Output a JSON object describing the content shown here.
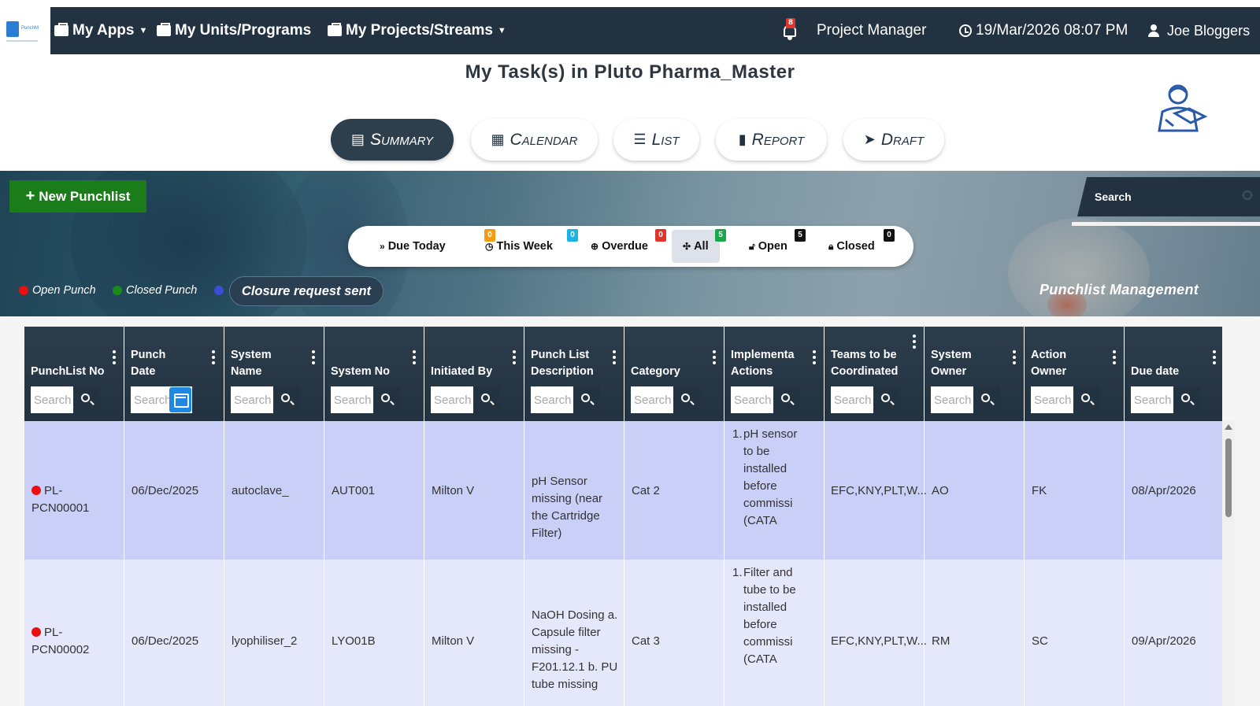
{
  "topbar": {
    "logo_text": "PunchM",
    "menus": [
      {
        "label": "My Apps",
        "has_caret": true
      },
      {
        "label": "My Units/Programs",
        "has_caret": false
      },
      {
        "label": "My Projects/Streams",
        "has_caret": true
      }
    ],
    "notification_count": "8",
    "role": "Project Manager",
    "datetime": "19/Mar/2026 08:07 PM",
    "user": "Joe Bloggers"
  },
  "page_title": "My Task(s) in Pluto Pharma_Master",
  "tabs": [
    {
      "label": "Summary",
      "icon": "summary-icon",
      "active": true
    },
    {
      "label": "Calendar",
      "icon": "calendar-icon",
      "active": false
    },
    {
      "label": "List",
      "icon": "list-icon",
      "active": false
    },
    {
      "label": "Report",
      "icon": "report-icon",
      "active": false
    },
    {
      "label": "Draft",
      "icon": "paper-plane-icon",
      "active": false
    }
  ],
  "hero": {
    "new_button": "New Punchlist",
    "search_placeholder": "Search",
    "filters": [
      {
        "label": "Due Today",
        "count": "0",
        "color": "#f39c12"
      },
      {
        "label": "This Week",
        "count": "0",
        "color": "#1ab3e6"
      },
      {
        "label": "Overdue",
        "count": "0",
        "color": "#e0342c"
      },
      {
        "label": "All",
        "count": "5",
        "color": "#1aa84a",
        "active": true
      },
      {
        "label": "Open",
        "count": "5",
        "color": "#111111"
      },
      {
        "label": "Closed",
        "count": "0",
        "color": "#111111"
      }
    ],
    "legend": [
      {
        "label": "Open Punch",
        "color": "#e81010"
      },
      {
        "label": "Closed Punch",
        "color": "#1a8a1a"
      },
      {
        "label": "Closure request sent",
        "color": "#3b4dd8"
      }
    ],
    "section_title": "Punchlist Management"
  },
  "table": {
    "columns": [
      {
        "label": "PunchList No"
      },
      {
        "label": "Punch Date"
      },
      {
        "label": "System Name"
      },
      {
        "label": "System No"
      },
      {
        "label": "Initiated By"
      },
      {
        "label": "Punch List Description"
      },
      {
        "label": "Category"
      },
      {
        "label": "Implementa Actions"
      },
      {
        "label": "Teams to be Coordinated"
      },
      {
        "label": "System Owner"
      },
      {
        "label": "Action Owner"
      },
      {
        "label": "Due date"
      }
    ],
    "search_placeholder": "Search",
    "rows": [
      {
        "punch_no": "PL-PCN00001",
        "date": "06/Dec/2025",
        "system_name": "autoclave_",
        "system_no": "AUT001",
        "initiated_by": "Milton V",
        "description": "pH Sensor missing (near the Cartridge Filter)",
        "category": "Cat 2",
        "actions": "pH sensor to be installed before commissi (CATA",
        "teams": "EFC,KNY,PLT,W...",
        "system_owner": "AO",
        "action_owner": "FK",
        "due": "08/Apr/2026"
      },
      {
        "punch_no": "PL-PCN00002",
        "date": "06/Dec/2025",
        "system_name": "lyophiliser_2",
        "system_no": "LYO01B",
        "initiated_by": "Milton V",
        "description": "NaOH Dosing a. Capsule filter missing - F201.12.1 b. PU tube missing",
        "category": "Cat 3",
        "actions": "Filter and tube to be installed before commissi (CATA",
        "teams": "EFC,KNY,PLT,W...",
        "system_owner": "RM",
        "action_owner": "SC",
        "due": "09/Apr/2026"
      }
    ]
  }
}
